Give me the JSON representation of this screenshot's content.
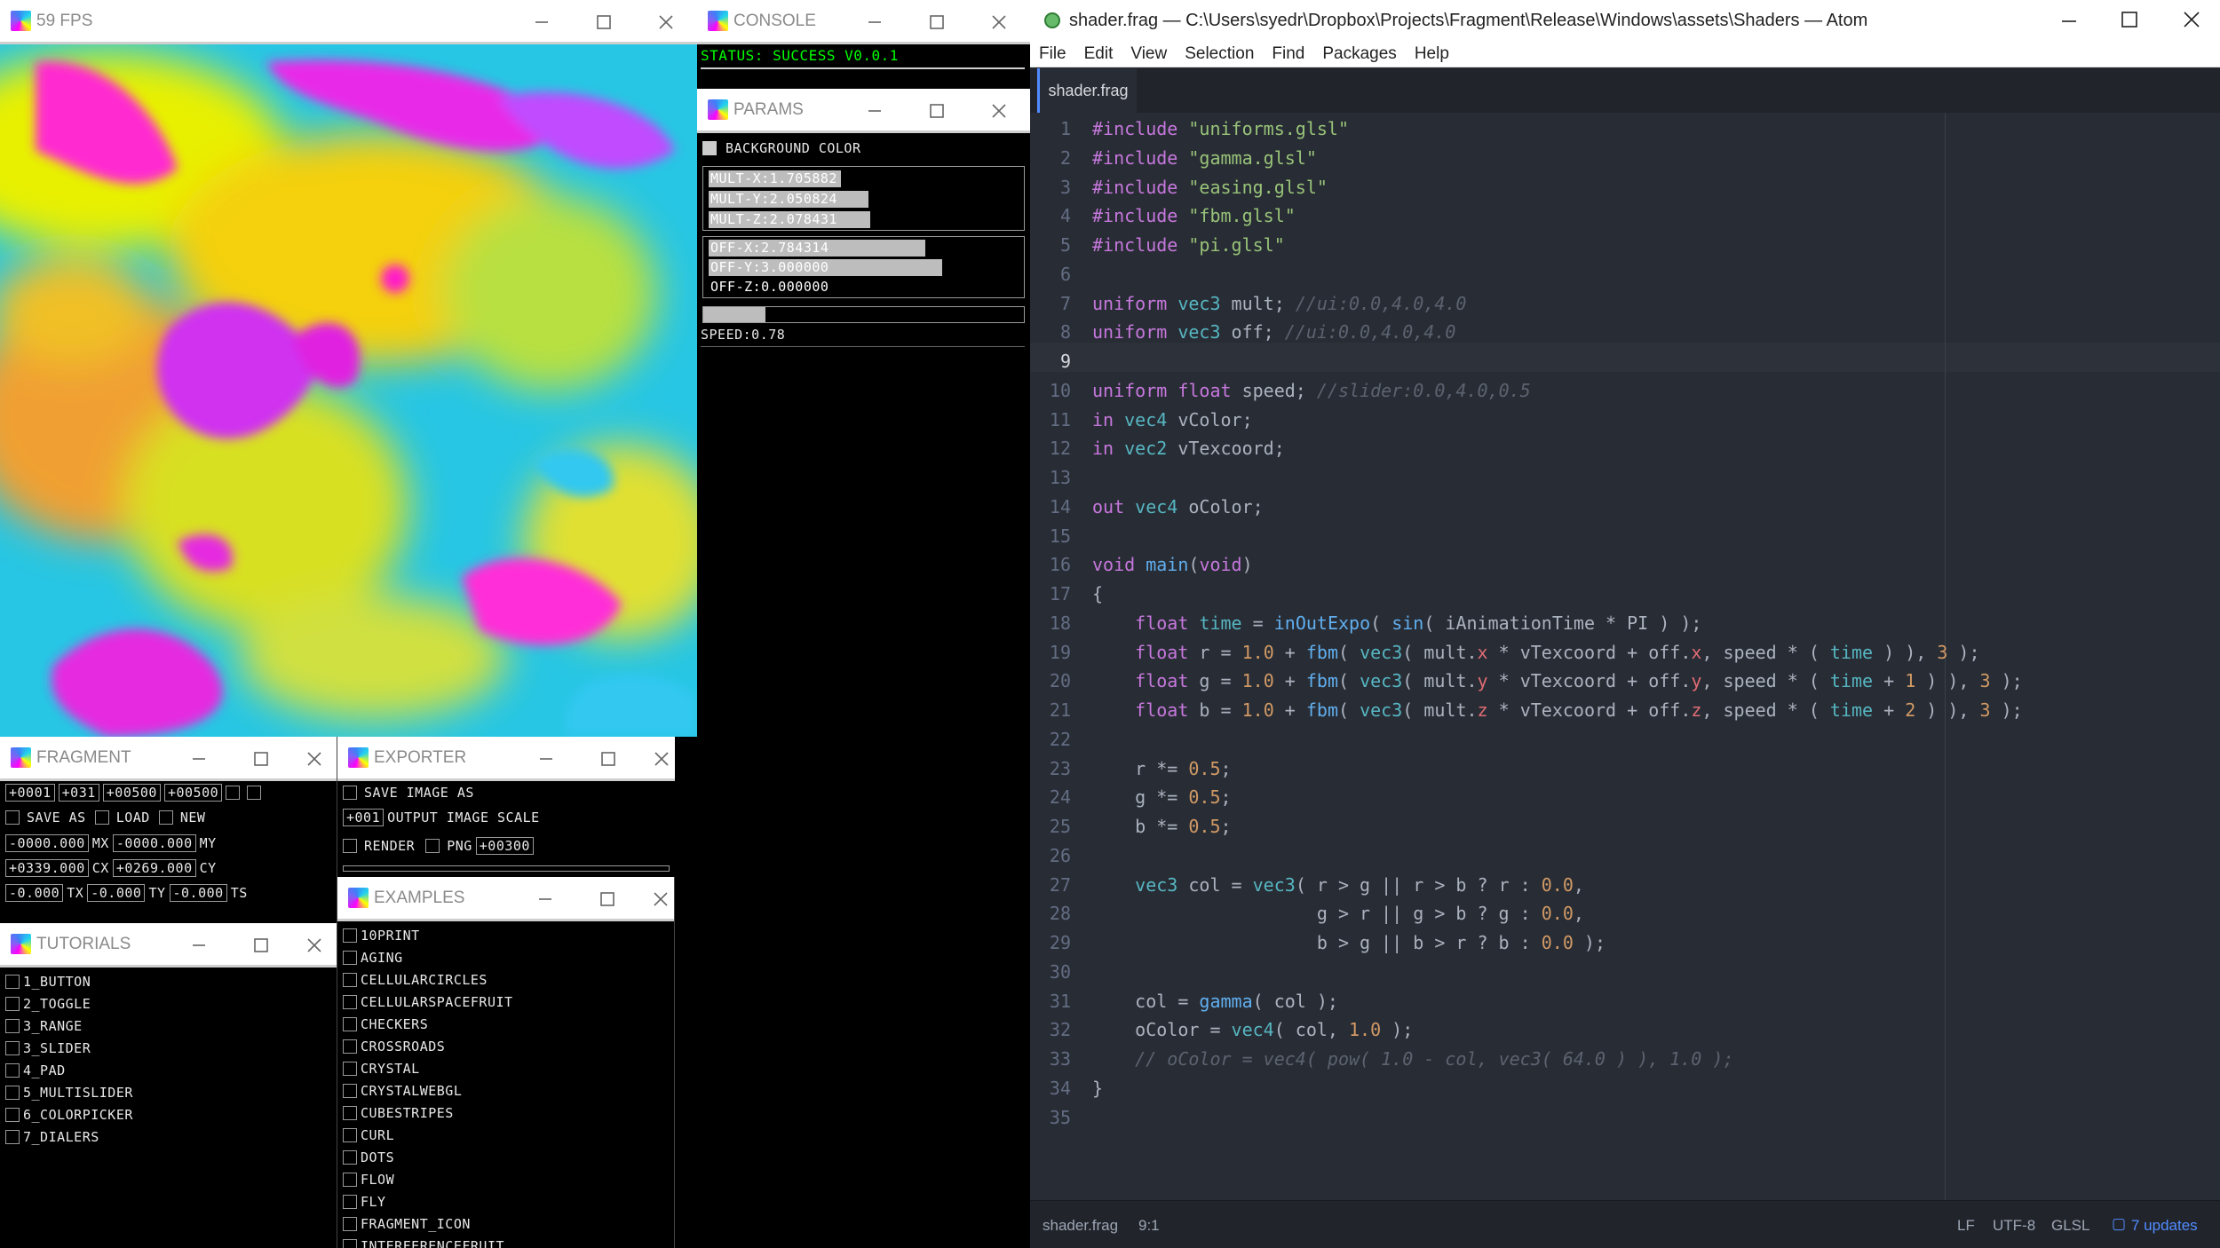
{
  "preview": {
    "title": "59 FPS"
  },
  "console": {
    "title": "CONSOLE",
    "status": "STATUS: SUCCESS V0.0.1"
  },
  "params": {
    "title": "PARAMS",
    "bg_label": "BACKGROUND COLOR",
    "mult": [
      {
        "label": "MULT-X:1.705882",
        "fill": 0.426
      },
      {
        "label": "MULT-Y:2.050824",
        "fill": 0.513
      },
      {
        "label": "MULT-Z:2.078431",
        "fill": 0.52
      }
    ],
    "off": [
      {
        "label": "OFF-X:2.784314",
        "fill": 0.696
      },
      {
        "label": "OFF-Y:3.000000",
        "fill": 0.75
      },
      {
        "label": "OFF-Z:0.000000",
        "fill": 0.0
      }
    ],
    "speed": {
      "label": "SPEED:0.78",
      "fill": 0.195
    }
  },
  "fragment": {
    "title": "FRAGMENT",
    "row1": [
      "+0001",
      "+031",
      "+00500",
      "+00500"
    ],
    "save_as": "SAVE AS",
    "load": "LOAD",
    "new": "NEW",
    "mx": {
      "value": "-0000.000",
      "label": "MX"
    },
    "my": {
      "value": "-0000.000",
      "label": "MY"
    },
    "cx": {
      "value": "+0339.000",
      "label": "CX"
    },
    "cy": {
      "value": "+0269.000",
      "label": "CY"
    },
    "tx": {
      "value": "-0.000",
      "label": "TX"
    },
    "ty": {
      "value": "-0.000",
      "label": "TY"
    },
    "ts": {
      "value": "-0.000",
      "label": "TS"
    }
  },
  "exporter": {
    "title": "EXPORTER",
    "save_image": "SAVE IMAGE AS",
    "scale_value": "+001",
    "scale_label": "OUTPUT IMAGE SCALE",
    "render": "RENDER",
    "png": "PNG",
    "frames": "+00300"
  },
  "tutorials": {
    "title": "TUTORIALS",
    "items": [
      "1_BUTTON",
      "2_TOGGLE",
      "3_RANGE",
      "3_SLIDER",
      "4_PAD",
      "5_MULTISLIDER",
      "6_COLORPICKER",
      "7_DIALERS"
    ]
  },
  "examples": {
    "title": "EXAMPLES",
    "items": [
      "10PRINT",
      "AGING",
      "CELLULARCIRCLES",
      "CELLULARSPACEFRUIT",
      "CHECKERS",
      "CROSSROADS",
      "CRYSTAL",
      "CRYSTALWEBGL",
      "CUBESTRIPES",
      "CURL",
      "DOTS",
      "FLOW",
      "FLY",
      "FRAGMENT_ICON",
      "INTERFERENCEFRUIT"
    ]
  },
  "atom": {
    "title": "shader.frag — C:\\Users\\syedr\\Dropbox\\Projects\\Fragment\\Release\\Windows\\assets\\Shaders — Atom",
    "menu": [
      "File",
      "Edit",
      "View",
      "Selection",
      "Find",
      "Packages",
      "Help"
    ],
    "tab": "shader.frag",
    "status": {
      "file": "shader.frag",
      "cursor": "9:1",
      "eol": "LF",
      "encoding": "UTF-8",
      "grammar": "GLSL",
      "updates": "7 updates"
    },
    "code": [
      "#include \"uniforms.glsl\"",
      "#include \"gamma.glsl\"",
      "#include \"easing.glsl\"",
      "#include \"fbm.glsl\"",
      "#include \"pi.glsl\"",
      "",
      "uniform vec3 mult; //ui:0.0,4.0,4.0",
      "uniform vec3 off; //ui:0.0,4.0,4.0",
      "",
      "uniform float speed; //slider:0.0,4.0,0.5",
      "in vec4 vColor;",
      "in vec2 vTexcoord;",
      "",
      "out vec4 oColor;",
      "",
      "void main(void)",
      "{",
      "    float time = inOutExpo( sin( iAnimationTime * PI ) );",
      "    float r = 1.0 + fbm( vec3( mult.x * vTexcoord + off.x, speed * ( time ) ), 3 );",
      "    float g = 1.0 + fbm( vec3( mult.y * vTexcoord + off.y, speed * ( time + 1 ) ), 3 );",
      "    float b = 1.0 + fbm( vec3( mult.z * vTexcoord + off.z, speed * ( time + 2 ) ), 3 );",
      "",
      "    r *= 0.5;",
      "    g *= 0.5;",
      "    b *= 0.5;",
      "",
      "    vec3 col = vec3( r > g || r > b ? r : 0.0,",
      "                     g > r || g > b ? g : 0.0,",
      "                     b > g || b > r ? b : 0.0 );",
      "",
      "    col = gamma( col );",
      "    oColor = vec4( col, 1.0 );",
      "    // oColor = vec4( pow( 1.0 - col, vec3( 64.0 ) ), 1.0 );",
      "}",
      ""
    ]
  },
  "colors": {
    "accent": "#528bff",
    "editor_bg": "#282c34",
    "status_green": "#00ff00"
  }
}
